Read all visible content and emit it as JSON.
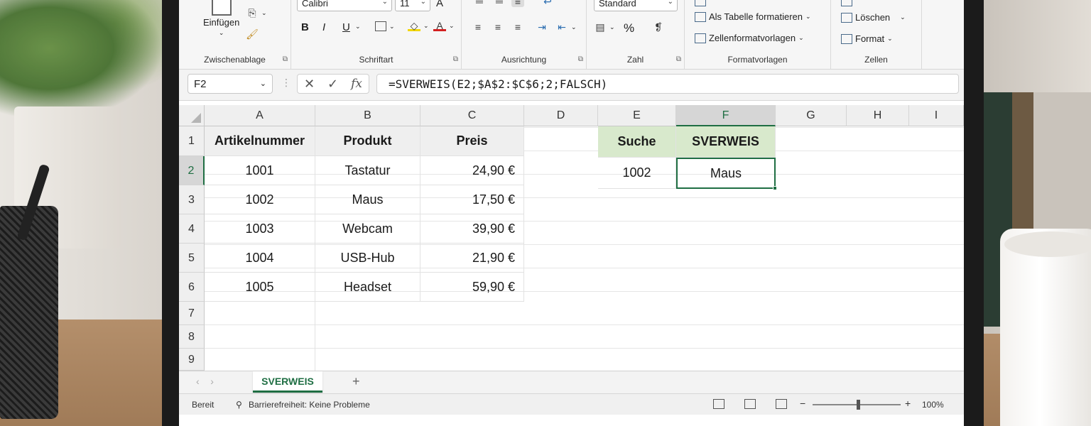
{
  "ribbon": {
    "clipboard": {
      "paste_label": "Einfügen",
      "group_label": "Zwischenablage"
    },
    "font": {
      "font_name": "Calibri",
      "font_size": "11",
      "bold": "B",
      "italic": "I",
      "underline": "U",
      "group_label": "Schriftart"
    },
    "alignment": {
      "group_label": "Ausrichtung"
    },
    "number": {
      "format": "Standard",
      "percent": "%",
      "group_label": "Zahl"
    },
    "styles": {
      "as_table": "Als Tabelle formatieren",
      "cell_styles": "Zellenformatvorlagen",
      "group_label": "Formatvorlagen"
    },
    "cells": {
      "delete": "Löschen",
      "format": "Format",
      "group_label": "Zellen"
    }
  },
  "formula_bar": {
    "name_box": "F2",
    "fx": "fx",
    "formula": "=SVERWEIS(E2;$A$2:$C$6;2;FALSCH)"
  },
  "columns": [
    "A",
    "B",
    "C",
    "D",
    "E",
    "F",
    "G",
    "H",
    "I"
  ],
  "rows": [
    "1",
    "2",
    "3",
    "4",
    "5",
    "6",
    "7",
    "8",
    "9"
  ],
  "table": {
    "headers": [
      "Artikelnummer",
      "Produkt",
      "Preis"
    ],
    "rows": [
      [
        "1001",
        "Tastatur",
        "24,90 €"
      ],
      [
        "1002",
        "Maus",
        "17,50 €"
      ],
      [
        "1003",
        "Webcam",
        "39,90 €"
      ],
      [
        "1004",
        "USB-Hub",
        "21,90 €"
      ],
      [
        "1005",
        "Headset",
        "59,90 €"
      ]
    ]
  },
  "lookup": {
    "search_header": "Suche",
    "result_header": "SVERWEIS",
    "search_value": "1002",
    "result_value": "Maus"
  },
  "sheet": {
    "tab_name": "SVERWEIS",
    "add": "+"
  },
  "status": {
    "ready": "Bereit",
    "accessibility": "Barrierefreiheit: Keine Probleme",
    "zoom": "100%"
  },
  "colors": {
    "accent_green": "#1f6e43",
    "header_fill": "#d8e9cc"
  }
}
